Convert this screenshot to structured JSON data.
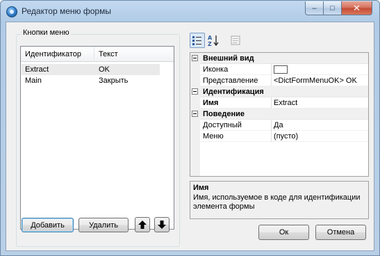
{
  "window": {
    "title": "Редактор меню формы",
    "controls": {
      "minimize": "–",
      "maximize": "□",
      "close": "✕"
    }
  },
  "menu_buttons": {
    "group_label": "Кнопки меню",
    "columns": [
      "Идентификатор",
      "Текст"
    ],
    "rows": [
      {
        "id": "Extract",
        "text": "OK"
      },
      {
        "id": "Main",
        "text": "Закрыть"
      }
    ],
    "selected_index": 0,
    "add_label": "Добавить",
    "delete_label": "Удалить",
    "move_up_icon": "arrow-up-icon",
    "move_down_icon": "arrow-down-icon"
  },
  "property_grid": {
    "toolbar": [
      "categorized-icon",
      "sort-alpha-icon",
      "property-pages-icon"
    ],
    "categories": [
      {
        "name": "Внешний вид",
        "props": [
          {
            "name": "Иконка",
            "value": "",
            "bold": false,
            "icon_box": true
          },
          {
            "name": "Представление",
            "value": "<DictFormMenuOK> OK",
            "bold": false
          }
        ]
      },
      {
        "name": "Идентификация",
        "props": [
          {
            "name": "Имя",
            "value": "Extract",
            "bold": true
          }
        ]
      },
      {
        "name": "Поведение",
        "props": [
          {
            "name": "Доступный",
            "value": "Да",
            "bold": false
          },
          {
            "name": "Меню",
            "value": "(пусто)",
            "bold": false
          }
        ]
      }
    ]
  },
  "help": {
    "title": "Имя",
    "description": "Имя, используемое в коде для идентификации элемента формы"
  },
  "dialog": {
    "ok_label": "Ок",
    "cancel_label": "Отмена"
  }
}
